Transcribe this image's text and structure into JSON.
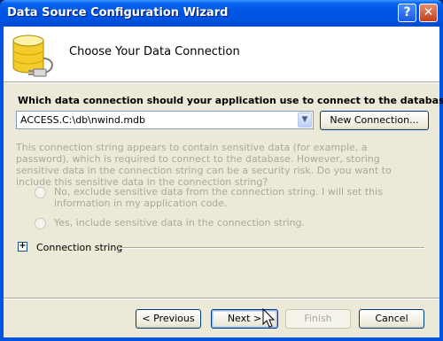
{
  "window": {
    "title": "Data Source Configuration Wizard"
  },
  "title_buttons": {
    "help": "?",
    "close": "✕"
  },
  "header": {
    "title": "Choose Your Data Connection",
    "icon": "database-plug-icon"
  },
  "connection": {
    "question": "Which data connection should your application use to connect to the database?",
    "selected": "ACCESS.C:\\db\\nwind.mdb",
    "new_connection_label": "New Connection..."
  },
  "sensitive": {
    "info": "This connection string appears to contain sensitive data (for example, a password), which is required to connect to the database. However, storing sensitive data in the connection string can be a security risk. Do you want to include this sensitive data in the connection string?",
    "option_no": "No, exclude sensitive data from the connection string. I will set this information in my application code.",
    "option_yes": "Yes, include sensitive data in the connection string."
  },
  "connection_string": {
    "label": "Connection string",
    "expand_symbol": "+"
  },
  "footer": {
    "previous": "< Previous",
    "next": "Next >",
    "finish": "Finish",
    "cancel": "Cancel"
  },
  "colors": {
    "titlebar": "#0054e3",
    "dialog_bg": "#ece9d8",
    "disabled_text": "#aca899"
  }
}
